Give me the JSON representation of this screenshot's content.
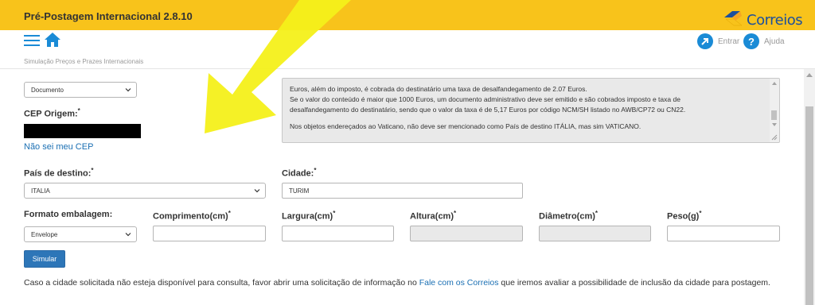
{
  "header": {
    "app_title": "Pré-Postagem Internacional 2.8.10",
    "logo_text": "Correios",
    "entrar_label": "Entrar",
    "ajuda_label": "Ajuda",
    "ajuda_icon_text": "?"
  },
  "breadcrumb": "Simulação Preços e Prazes Internacionais",
  "form": {
    "tipo_select_value": "Documento",
    "cep_origem_label": "CEP Origem:",
    "cep_link": "Não sei meu CEP",
    "info_lines": [
      "Euros, além do imposto, é cobrada do destinatário uma taxa de desalfandegamento de 2.07 Euros.",
      "Se o valor do conteúdo é maior que 1000 Euros, um documento administrativo deve ser emitido e são cobrados imposto e taxa de",
      "desalfandegamento do destinatário, sendo que o valor da taxa é de 5,17 Euros por código NCM/SH listado no AWB/CP72 ou CN22.",
      "Nos objetos endereçados ao Vaticano, não deve ser mencionado como País de destino ITÁLIA, mas sim VATICANO."
    ],
    "pais_label": "País de destino:",
    "pais_value": "ITALIA",
    "cidade_label": "Cidade:",
    "cidade_value": "TURIM",
    "formato_label": "Formato embalagem:",
    "formato_value": "Envelope",
    "comprimento_label": "Comprimento(cm)",
    "largura_label": "Largura(cm)",
    "altura_label": "Altura(cm)",
    "diametro_label": "Diâmetro(cm)",
    "peso_label": "Peso(g)",
    "required_mark": "*",
    "simular_label": "Simular"
  },
  "footnote": {
    "before": "Caso a cidade solicitada não esteja disponível para consulta, favor abrir uma solicitação de informação no ",
    "link": "Fale com os Correios",
    "after": " que iremos avaliar a possibilidade de inclusão da cidade para postagem."
  },
  "colors": {
    "topbar": "#f8c31b",
    "accent_blue": "#1a8bd6",
    "button_blue": "#2d76b8",
    "overlay_arrow": "#f4f01a"
  }
}
